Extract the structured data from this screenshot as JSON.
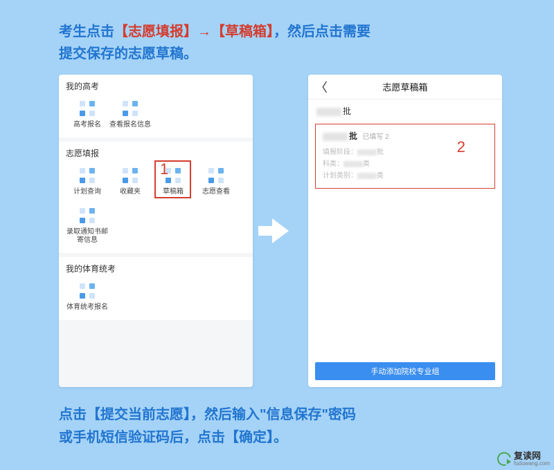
{
  "instruction_top": {
    "p1": "考生点击",
    "p2": "【志愿填报】→【草稿箱】",
    "p3": "，然后点击需要",
    "p4": "提交保存的志愿草稿。"
  },
  "instruction_bottom": {
    "p1": "点击【提交当前志愿】，然后输入\"信息保存\"密码",
    "p2": "或手机短信验证码后，点击【确定】。"
  },
  "left_screen": {
    "section1": {
      "title": "我的高考",
      "items": [
        "高考报名",
        "查看报名信息"
      ]
    },
    "section2": {
      "title": "志愿填报",
      "items_row1": [
        "计划查询",
        "收藏夹",
        "草稿箱",
        "志愿查看"
      ],
      "items_row2": [
        "录取通知书邮寄信息"
      ]
    },
    "section3": {
      "title": "我的体育统考",
      "items": [
        "体育统考报名"
      ]
    }
  },
  "right_screen": {
    "header_title": "志愿草稿箱",
    "tab_suffix": "批",
    "card": {
      "title_suffix": "批",
      "filled": "已填写 2",
      "line1_label": "填报阶段：",
      "line1_suffix": "批",
      "line2_label": "科类：",
      "line2_suffix": "类",
      "line3_label": "计划类别：",
      "line3_suffix": "类"
    },
    "bottom_button": "手动添加院校专业组"
  },
  "markers": {
    "one": "1",
    "two": "2"
  },
  "watermark": {
    "main": "复读网",
    "sub": "fuduwang.com"
  }
}
